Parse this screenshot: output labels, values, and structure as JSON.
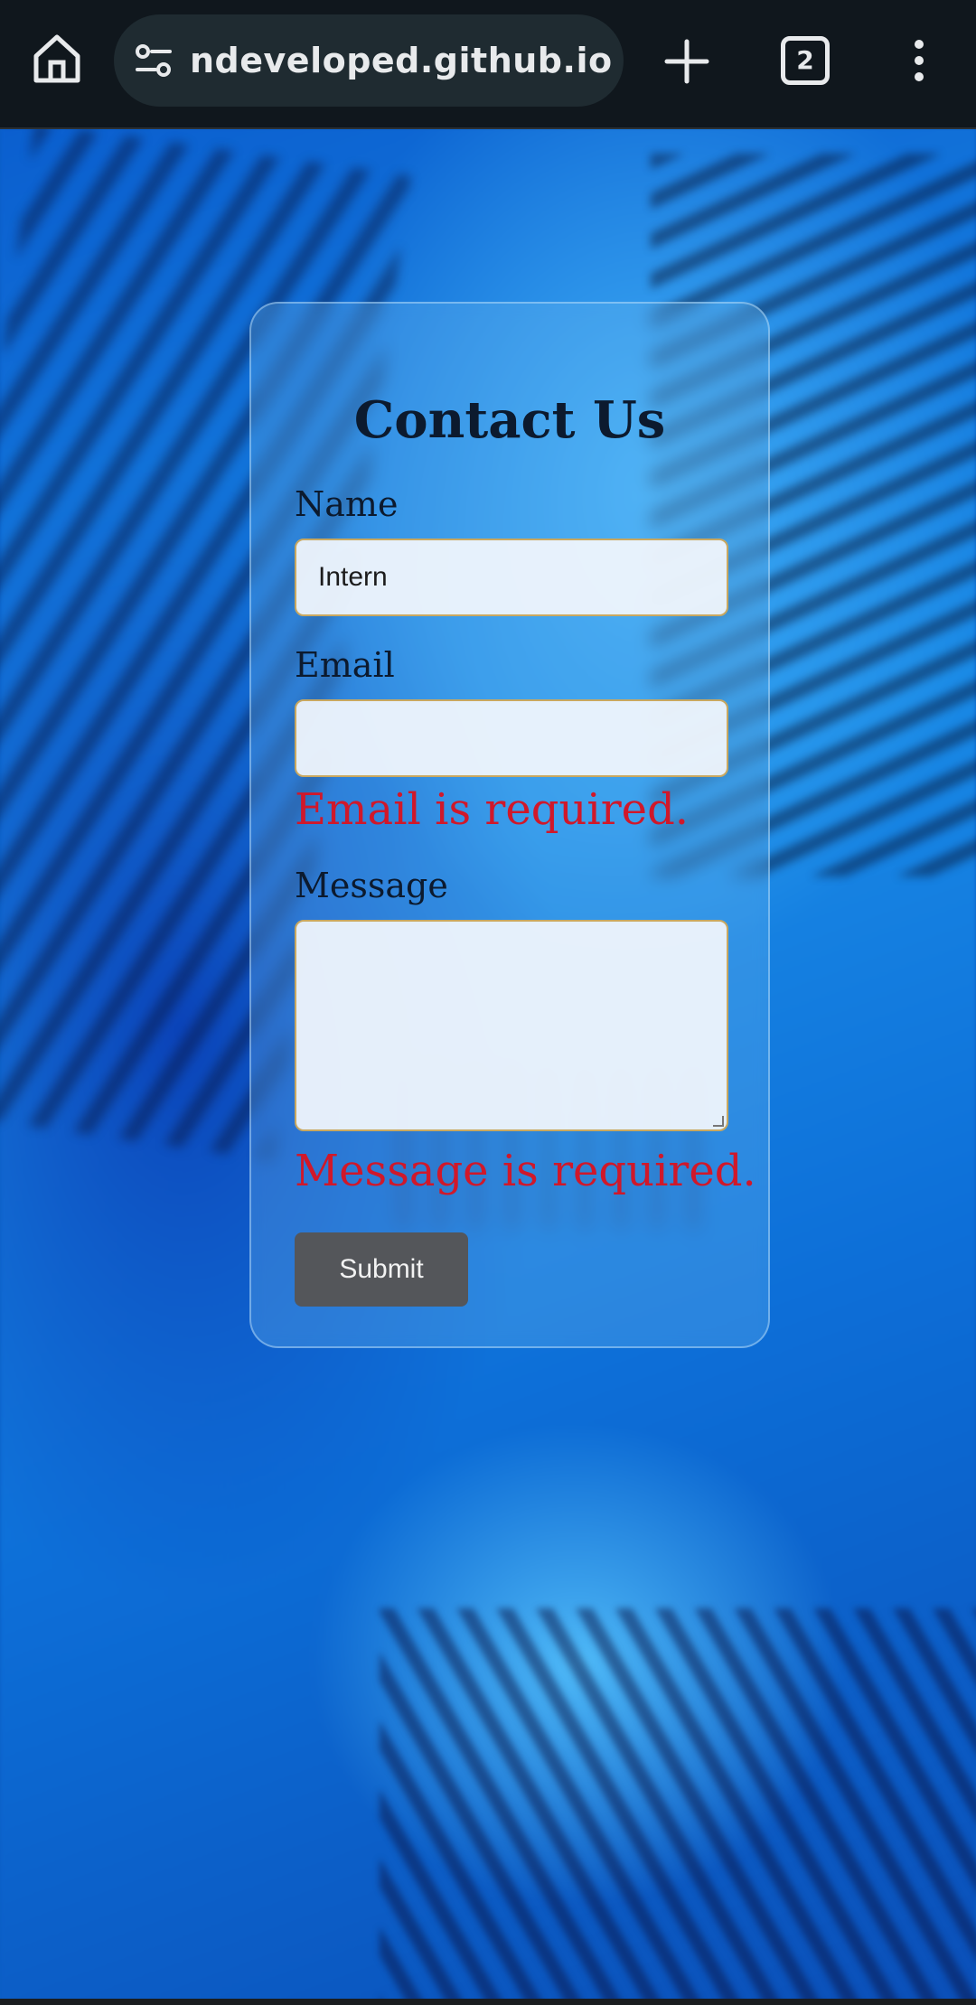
{
  "browser": {
    "url": "ndeveloped.github.io",
    "tab_count": "2",
    "home_icon": "home-icon",
    "site_info_icon": "site-settings-icon",
    "new_tab_icon": "plus-icon",
    "menu_icon": "more-vert-icon"
  },
  "form": {
    "title": "Contact Us",
    "name_label": "Name",
    "name_value": "Intern",
    "email_label": "Email",
    "email_value": "",
    "email_error": "Email is required.",
    "message_label": "Message",
    "message_value": "",
    "message_error": "Message is required.",
    "submit_label": "Submit"
  },
  "colors": {
    "error": "#d0182a",
    "submit_bg": "#54565a",
    "field_border": "#c9a860",
    "topbar_bg": "#10171d"
  }
}
